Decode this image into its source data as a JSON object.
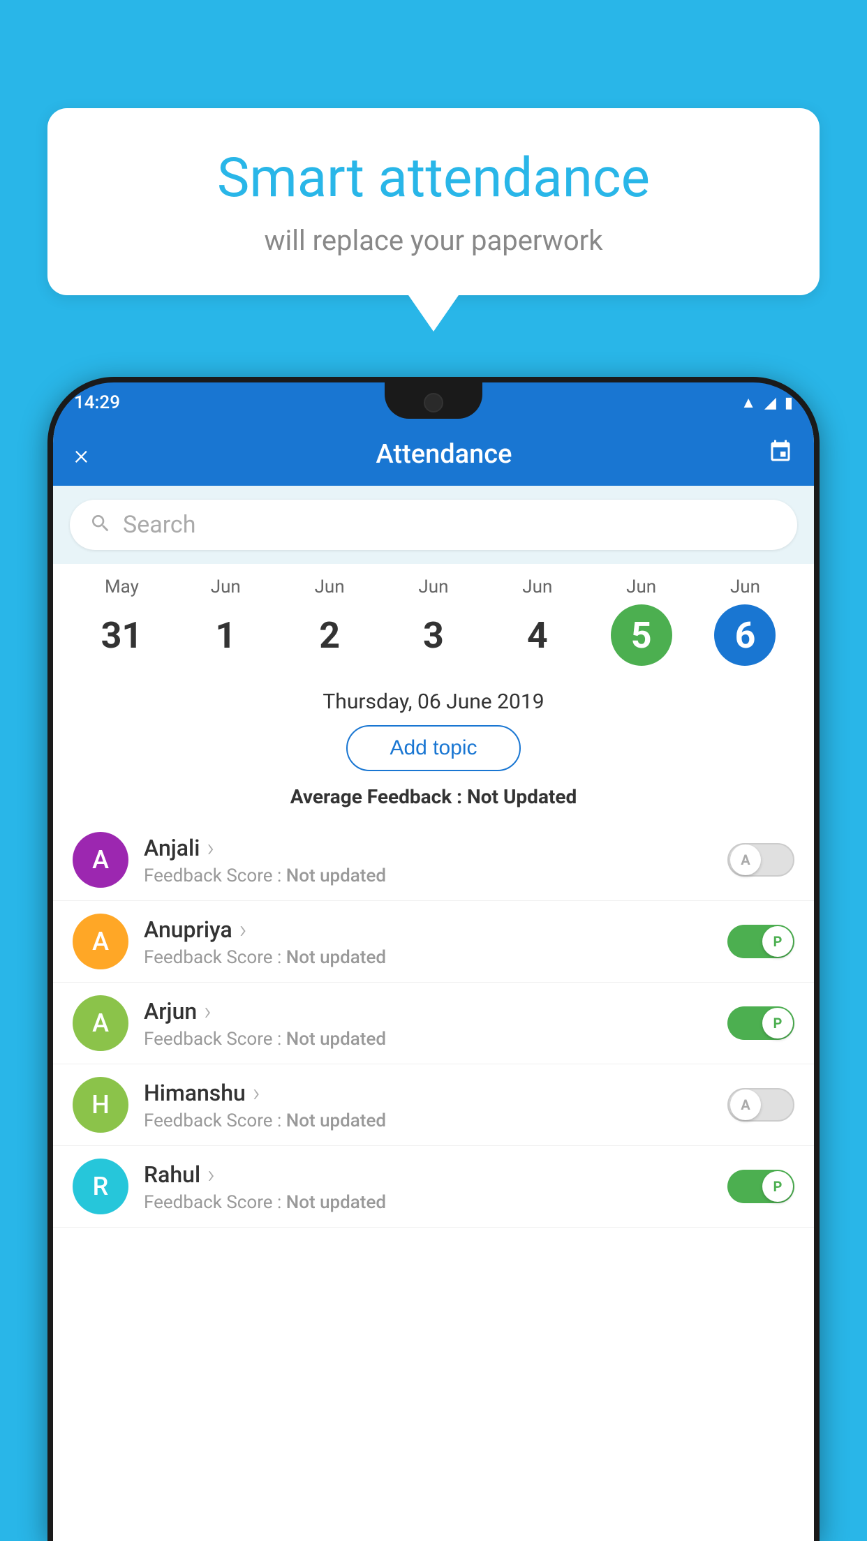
{
  "background_color": "#29b6e8",
  "bubble": {
    "title": "Smart attendance",
    "subtitle": "will replace your paperwork"
  },
  "status_bar": {
    "time": "14:29",
    "wifi_icon": "wifi",
    "signal_icon": "signal",
    "battery_icon": "battery"
  },
  "header": {
    "title": "Attendance",
    "close_label": "×",
    "calendar_icon": "calendar"
  },
  "search": {
    "placeholder": "Search"
  },
  "calendar": {
    "days": [
      {
        "month": "May",
        "num": "31",
        "state": "normal"
      },
      {
        "month": "Jun",
        "num": "1",
        "state": "normal"
      },
      {
        "month": "Jun",
        "num": "2",
        "state": "normal"
      },
      {
        "month": "Jun",
        "num": "3",
        "state": "normal"
      },
      {
        "month": "Jun",
        "num": "4",
        "state": "normal"
      },
      {
        "month": "Jun",
        "num": "5",
        "state": "today"
      },
      {
        "month": "Jun",
        "num": "6",
        "state": "selected"
      }
    ],
    "selected_date": "Thursday, 06 June 2019"
  },
  "add_topic": {
    "label": "Add topic"
  },
  "avg_feedback": {
    "label_prefix": "Average Feedback : ",
    "label_value": "Not Updated"
  },
  "students": [
    {
      "name": "Anjali",
      "initial": "A",
      "avatar_color": "#9c27b0",
      "feedback": "Feedback Score : ",
      "feedback_value": "Not updated",
      "attendance": "absent",
      "toggle_label": "A"
    },
    {
      "name": "Anupriya",
      "initial": "A",
      "avatar_color": "#ffa726",
      "feedback": "Feedback Score : ",
      "feedback_value": "Not updated",
      "attendance": "present",
      "toggle_label": "P"
    },
    {
      "name": "Arjun",
      "initial": "A",
      "avatar_color": "#8bc34a",
      "feedback": "Feedback Score : ",
      "feedback_value": "Not updated",
      "attendance": "present",
      "toggle_label": "P"
    },
    {
      "name": "Himanshu",
      "initial": "H",
      "avatar_color": "#8bc34a",
      "feedback": "Feedback Score : ",
      "feedback_value": "Not updated",
      "attendance": "absent",
      "toggle_label": "A"
    },
    {
      "name": "Rahul",
      "initial": "R",
      "avatar_color": "#26c6da",
      "feedback": "Feedback Score : ",
      "feedback_value": "Not updated",
      "attendance": "present",
      "toggle_label": "P"
    }
  ]
}
